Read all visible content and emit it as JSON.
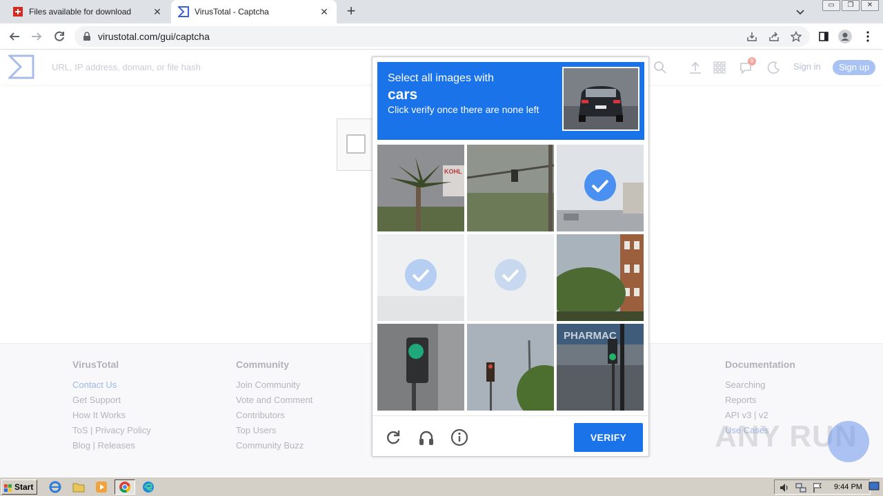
{
  "browser": {
    "tabs": [
      {
        "title": "Files available for download",
        "state": "inactive",
        "favicon": "swiss-flag-icon"
      },
      {
        "title": "VirusTotal - Captcha",
        "state": "active",
        "favicon": "virustotal-icon"
      }
    ],
    "close_glyph": "✕",
    "new_tab_glyph": "+",
    "url": "virustotal.com/gui/captcha",
    "window_buttons": [
      "▭",
      "❐",
      "✕"
    ]
  },
  "vt": {
    "search_placeholder": "URL, IP address, domain, or file hash",
    "notification_count": "9",
    "signin": "Sign in",
    "signup": "Sign up"
  },
  "captcha": {
    "instruction": "Select all images with",
    "target": "cars",
    "hint": "Click verify once there are none left",
    "tiles": [
      {
        "subject": "palm tree with store sign",
        "selected": false
      },
      {
        "subject": "noisy street with traffic light",
        "selected": false
      },
      {
        "subject": "street with cars",
        "selected": true
      },
      {
        "subject": "blank road scene",
        "selected": true
      },
      {
        "subject": "blank road scene",
        "selected": true
      },
      {
        "subject": "brick building with trees",
        "selected": false
      },
      {
        "subject": "green traffic light",
        "selected": false
      },
      {
        "subject": "traffic light by trees",
        "selected": false
      },
      {
        "subject": "pharmacy storefront with traffic light",
        "selected": false
      }
    ],
    "pharmacy_text": "PHARMAC",
    "sign_text": "KOHL",
    "verify_label": "VERIFY"
  },
  "footer": {
    "columns": [
      {
        "heading": "VirusTotal",
        "links": [
          "Contact Us",
          "Get Support",
          "How It Works",
          "ToS | Privacy Policy",
          "Blog | Releases"
        ]
      },
      {
        "heading": "Community",
        "links": [
          "Join Community",
          "Vote and Comment",
          "Contributors",
          "Top Users",
          "Community Buzz"
        ]
      },
      {
        "heading": "Documentation",
        "links": [
          "Searching",
          "Reports",
          "API v3 | v2",
          "Use Cases"
        ]
      }
    ],
    "watermark": "ANY RUN"
  },
  "taskbar": {
    "start_label": "Start",
    "clock": "9:44 PM"
  },
  "colors": {
    "captcha_blue": "#1a73e8",
    "tab_bar": "#dee1e6",
    "taskbar": "#d4d0c8"
  }
}
